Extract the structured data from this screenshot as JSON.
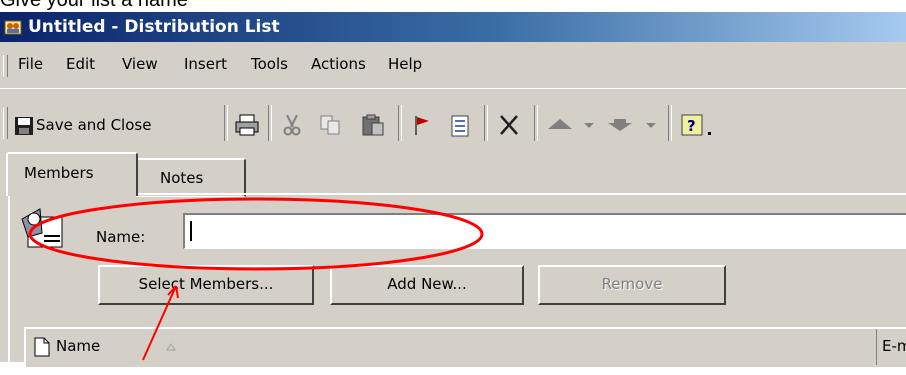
{
  "caption": "Give your list a name",
  "window": {
    "title": "Untitled - Distribution List"
  },
  "menu": {
    "items": [
      {
        "label": "File"
      },
      {
        "label": "Edit"
      },
      {
        "label": "View"
      },
      {
        "label": "Insert"
      },
      {
        "label": "Tools"
      },
      {
        "label": "Actions"
      },
      {
        "label": "Help"
      }
    ]
  },
  "toolbar": {
    "save_close_label": "Save and Close",
    "icons": [
      "save-icon",
      "print-icon",
      "cut-icon",
      "copy-icon",
      "paste-icon",
      "flag-icon",
      "insert-file-icon",
      "delete-icon",
      "previous-item-icon",
      "next-item-icon",
      "help-icon"
    ]
  },
  "tabs": [
    {
      "label": "Members",
      "selected": true
    },
    {
      "label": "Notes",
      "selected": false
    }
  ],
  "form": {
    "name_label": "Name:",
    "name_value": "",
    "select_members_label": "Select Members...",
    "add_new_label": "Add New...",
    "remove_label": "Remove"
  },
  "list": {
    "columns": [
      {
        "label": "Name"
      },
      {
        "label": "E-mail"
      }
    ]
  },
  "annotation": {
    "color": "#ff0000"
  }
}
